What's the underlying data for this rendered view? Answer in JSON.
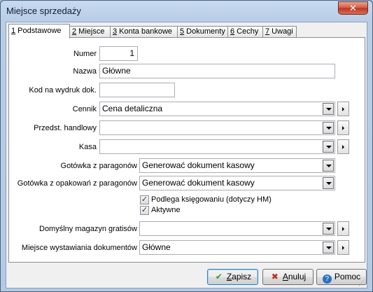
{
  "window": {
    "title": "Miejsce sprzedaży",
    "close_glyph": "✕"
  },
  "tabs": [
    {
      "key": "1",
      "label": " Podstawowe"
    },
    {
      "key": "2",
      "label": " Miejsce"
    },
    {
      "key": "3",
      "label": " Konta bankowe"
    },
    {
      "key": "5",
      "label": " Dokumenty"
    },
    {
      "key": "6",
      "label": " Cechy"
    },
    {
      "key": "7",
      "label": " Uwagi"
    }
  ],
  "form": {
    "numer": {
      "label": "Numer",
      "value": "1"
    },
    "nazwa": {
      "label": "Nazwa",
      "value": "Główne"
    },
    "kod": {
      "label": "Kod na wydruk dok.",
      "value": ""
    },
    "cennik": {
      "label": "Cennik",
      "value": "Cena detaliczna"
    },
    "przedst": {
      "label": "Przedst. handlowy",
      "value": ""
    },
    "kasa": {
      "label": "Kasa",
      "value": ""
    },
    "gotowka_paragon": {
      "label": "Gotówka z paragonów",
      "value": "Generować dokument kasowy"
    },
    "gotowka_opak": {
      "label": "Gotówka z opakowań z paragonów",
      "value": "Generować dokument kasowy"
    },
    "podlega": {
      "label": "Podlega księgowaniu (dotyczy HM)",
      "checked": true
    },
    "aktywne": {
      "label": "Aktywne",
      "checked": true
    },
    "magazyn": {
      "label": "Domyślny magazyn gratisów",
      "value": ""
    },
    "miejsce": {
      "label": "Miejsce wystawiania dokumentów",
      "value": "Główne"
    }
  },
  "buttons": {
    "zapisz": {
      "hotkey": "Z",
      "rest": "apisz"
    },
    "anuluj": {
      "hotkey": "A",
      "rest": "nuluj"
    },
    "pomoc": "Pomoc"
  },
  "check_glyph": "✓"
}
